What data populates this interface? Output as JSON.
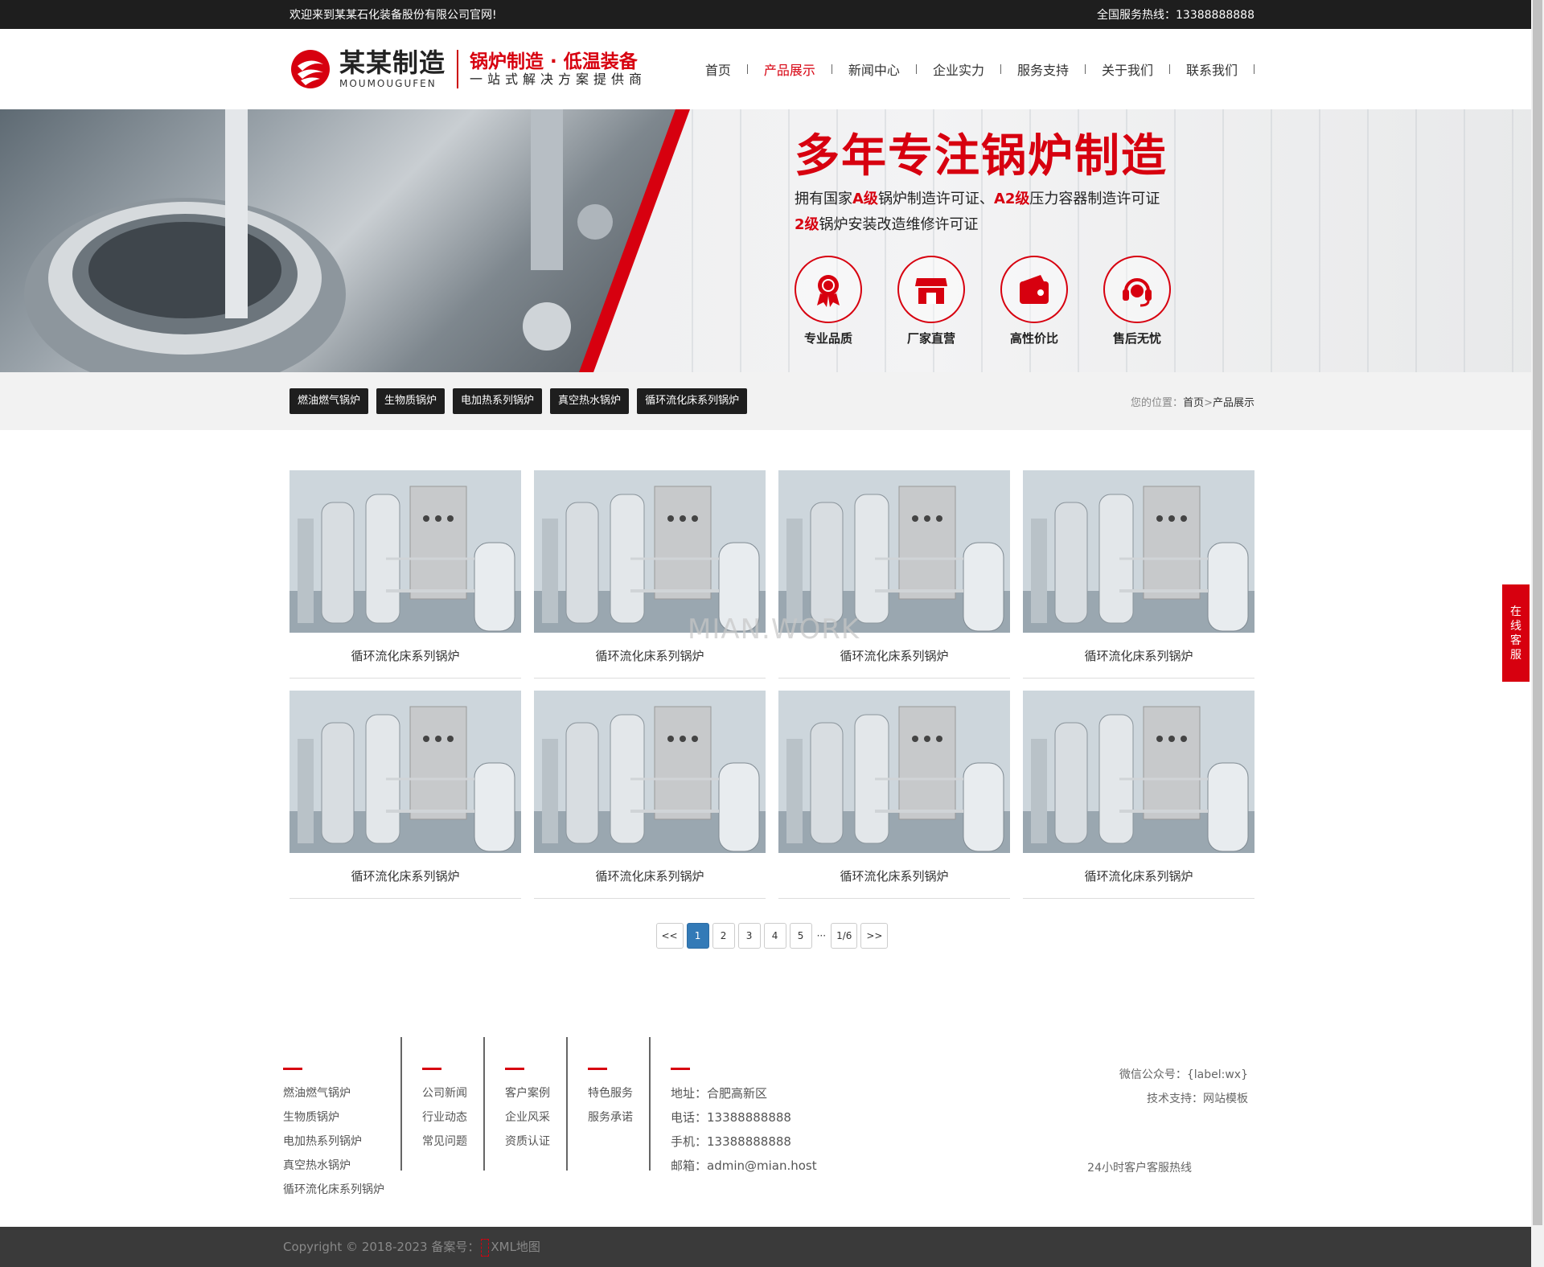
{
  "topbar": {
    "welcome": "欢迎来到某某石化装备股份有限公司官网!",
    "hotline": "全国服务热线：13388888888"
  },
  "logo": {
    "brand_cn": "某某制造",
    "brand_en": "MOUMOUGUFEN",
    "slogan1": "锅炉制造 · 低温装备",
    "slogan2": "一站式解决方案提供商"
  },
  "nav": {
    "items": [
      {
        "label": "首页"
      },
      {
        "label": "产品展示"
      },
      {
        "label": "新闻中心"
      },
      {
        "label": "企业实力"
      },
      {
        "label": "服务支持"
      },
      {
        "label": "关于我们"
      },
      {
        "label": "联系我们"
      }
    ],
    "active_color": "#d7000f"
  },
  "banner": {
    "headline": "多年专注锅炉制造",
    "line1_pre": "拥有国家",
    "line1_hl1": "A级",
    "line1_mid": "锅炉制造许可证、",
    "line1_hl2": "A2级",
    "line1_post": "压力容器制造许可证",
    "line2_hl": "2级",
    "line2_post": "锅炉安装改造维修许可证",
    "features": [
      {
        "label": "专业品质",
        "icon": "award-icon"
      },
      {
        "label": "厂家直营",
        "icon": "store-icon"
      },
      {
        "label": "高性价比",
        "icon": "wallet-icon"
      },
      {
        "label": "售后无忧",
        "icon": "headset-icon"
      }
    ]
  },
  "categories": [
    "燃油燃气锅炉",
    "生物质锅炉",
    "电加热系列锅炉",
    "真空热水锅炉",
    "循环流化床系列锅炉"
  ],
  "breadcrumb": {
    "prefix": "您的位置：",
    "home": "首页",
    "sep": ">",
    "current": "产品展示"
  },
  "products": [
    {
      "title": "循环流化床系列锅炉"
    },
    {
      "title": "循环流化床系列锅炉"
    },
    {
      "title": "循环流化床系列锅炉"
    },
    {
      "title": "循环流化床系列锅炉"
    },
    {
      "title": "循环流化床系列锅炉"
    },
    {
      "title": "循环流化床系列锅炉"
    },
    {
      "title": "循环流化床系列锅炉"
    },
    {
      "title": "循环流化床系列锅炉"
    }
  ],
  "watermark": "MIAN.WORK",
  "pagination": {
    "first": "<<",
    "pages": [
      "1",
      "2",
      "3",
      "4",
      "5"
    ],
    "current": "1",
    "dots": "···",
    "info": "1/6",
    "last": ">>"
  },
  "footer": {
    "col1": [
      "燃油燃气锅炉",
      "生物质锅炉",
      "电加热系列锅炉",
      "真空热水锅炉",
      "循环流化床系列锅炉"
    ],
    "col2": [
      "公司新闻",
      "行业动态",
      "常见问题"
    ],
    "col3": [
      "客户案例",
      "企业风采",
      "资质认证"
    ],
    "col4": [
      "特色服务",
      "服务承诺"
    ],
    "contact": {
      "address": "地址：合肥高新区",
      "phone": "电话：13388888888",
      "mobile": "手机：13388888888",
      "email": "邮箱：admin@mian.host"
    },
    "wechat": "微信公众号：{label:wx}",
    "support": "技术支持：网站模板",
    "hotline_label": "24小时客户客服热线"
  },
  "copyright": {
    "text": "Copyright © 2018-2023 备案号：",
    "sitemap": "XML地图"
  },
  "side_service": [
    "在",
    "线",
    "客",
    "服"
  ]
}
